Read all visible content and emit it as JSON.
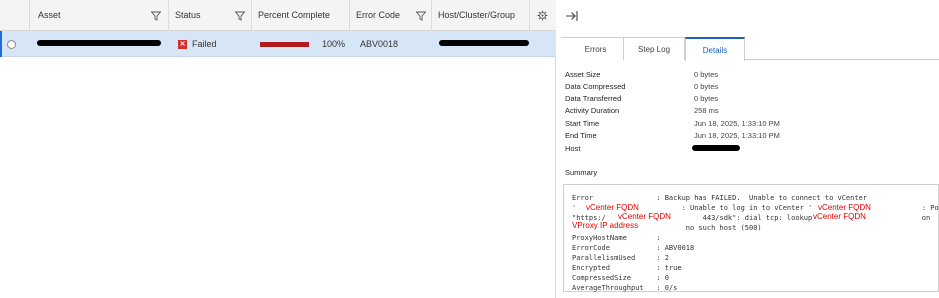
{
  "table": {
    "columns": [
      "Asset",
      "Status",
      "Percent Complete",
      "Error Code",
      "Host/Cluster/Group Name"
    ],
    "row": {
      "status": "Failed",
      "percent": "100%",
      "progress_fraction": 1.0,
      "error_code": "ABV0018"
    }
  },
  "tabs": [
    "Errors",
    "Step Log",
    "Details"
  ],
  "active_tab": "Details",
  "details": [
    {
      "key": "Asset Size",
      "value": "0 bytes"
    },
    {
      "key": "Data Compressed",
      "value": "0 bytes"
    },
    {
      "key": "Data Transferred",
      "value": "0 bytes"
    },
    {
      "key": "Activity Duration",
      "value": "258 ms"
    },
    {
      "key": "Start Time",
      "value": "Jun 18, 2025, 1:33:10 PM"
    },
    {
      "key": "End Time",
      "value": "Jun 18, 2025, 1:33:10 PM"
    },
    {
      "key": "Host",
      "value": ""
    }
  ],
  "summary_label": "Summary",
  "summary": {
    "line1": "Error               : Backup has FAILED.  Unable to connect to vCenter",
    "line2": "'                         : Unable to log in to vCenter '                          : Post",
    "line3": "\"https:/                       443/sdk\": dial tcp: lookup                          on",
    "line4": "                           no such host (500)",
    "line5": "ProxyHostName       :",
    "line6": "ErrorCode           : ABV0018",
    "line7": "ParallelismUsed     : 2",
    "line8": "Encrypted           : true",
    "line9": "CompressedSize      : 0",
    "line10": "AverageThroughput   : 0/s",
    "annotations": [
      "vCenter FQDN",
      "vCenter FQDN",
      "vCenter FQDN",
      "vCenter FQDN",
      "VProxy IP address"
    ]
  },
  "colors": {
    "accent": "#1f5fbf",
    "failed": "#d0312d",
    "selected_row": "#d6e6f7",
    "annotation": "#e00000"
  }
}
